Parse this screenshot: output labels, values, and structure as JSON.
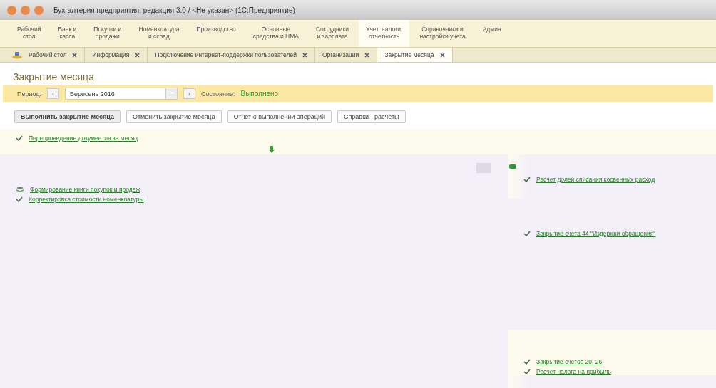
{
  "window": {
    "title": "Бухгалтерия предприятия, редакция 3.0 / <Не указан> (1С:Предприятие)"
  },
  "sections": [
    {
      "label": "Рабочий\nстол",
      "selected": false
    },
    {
      "label": "Банк и\nкасса",
      "selected": false
    },
    {
      "label": "Покупки и\nпродажи",
      "selected": false
    },
    {
      "label": "Номенклатура\nи склад",
      "selected": false
    },
    {
      "label": "Производство",
      "selected": false
    },
    {
      "label": "Основные\nсредства и НМА",
      "selected": false
    },
    {
      "label": "Сотрудники\nи зарплата",
      "selected": false
    },
    {
      "label": "Учет, налоги,\nотчетность",
      "selected": true
    },
    {
      "label": "Справочники и\nнастройки учета",
      "selected": false
    },
    {
      "label": "Админ",
      "selected": false
    }
  ],
  "tabs": [
    {
      "label": "Рабочий стол",
      "kind": "home",
      "selected": false
    },
    {
      "label": "Информация",
      "kind": "plain",
      "selected": false
    },
    {
      "label": "Подключение интернет-поддержки пользователей",
      "kind": "plain",
      "selected": false
    },
    {
      "label": "Организации",
      "kind": "plain",
      "selected": false
    },
    {
      "label": "Закрытие месяца",
      "kind": "plain",
      "selected": true
    }
  ],
  "page": {
    "title": "Закрытие месяца",
    "period_label": "Период:",
    "period_prev": "‹",
    "period": "Вересень 2016",
    "period_pick": "...",
    "period_next": "›",
    "state_label": "Состояние:",
    "state": "Выполнено"
  },
  "buttons": [
    {
      "label": "Выполнить закрытие месяца",
      "default": true
    },
    {
      "label": "Отменить закрытие месяца",
      "default": false
    },
    {
      "label": "Отчет о выполнении операций",
      "default": false
    },
    {
      "label": "Справки - расчеты",
      "default": false
    }
  ],
  "steps_top": [
    {
      "label": "Перепроведение документов за месяц",
      "kind": "check"
    }
  ],
  "steps_left": [
    {
      "label": "Формирование книги покупок и продаж",
      "kind": "stack"
    },
    {
      "label": "Корректировка стоимости номенклатуры",
      "kind": "check"
    }
  ],
  "steps_right": [
    {
      "label": "Расчет долей списания косвенных расход",
      "kind": "check"
    },
    {
      "label": "Закрытие счета 44 \"Издержки обращения\"",
      "kind": "check"
    },
    {
      "label": "Закрытие счетов 20, 26",
      "kind": "check"
    },
    {
      "label": "Расчет налога на прибыль",
      "kind": "check"
    }
  ]
}
